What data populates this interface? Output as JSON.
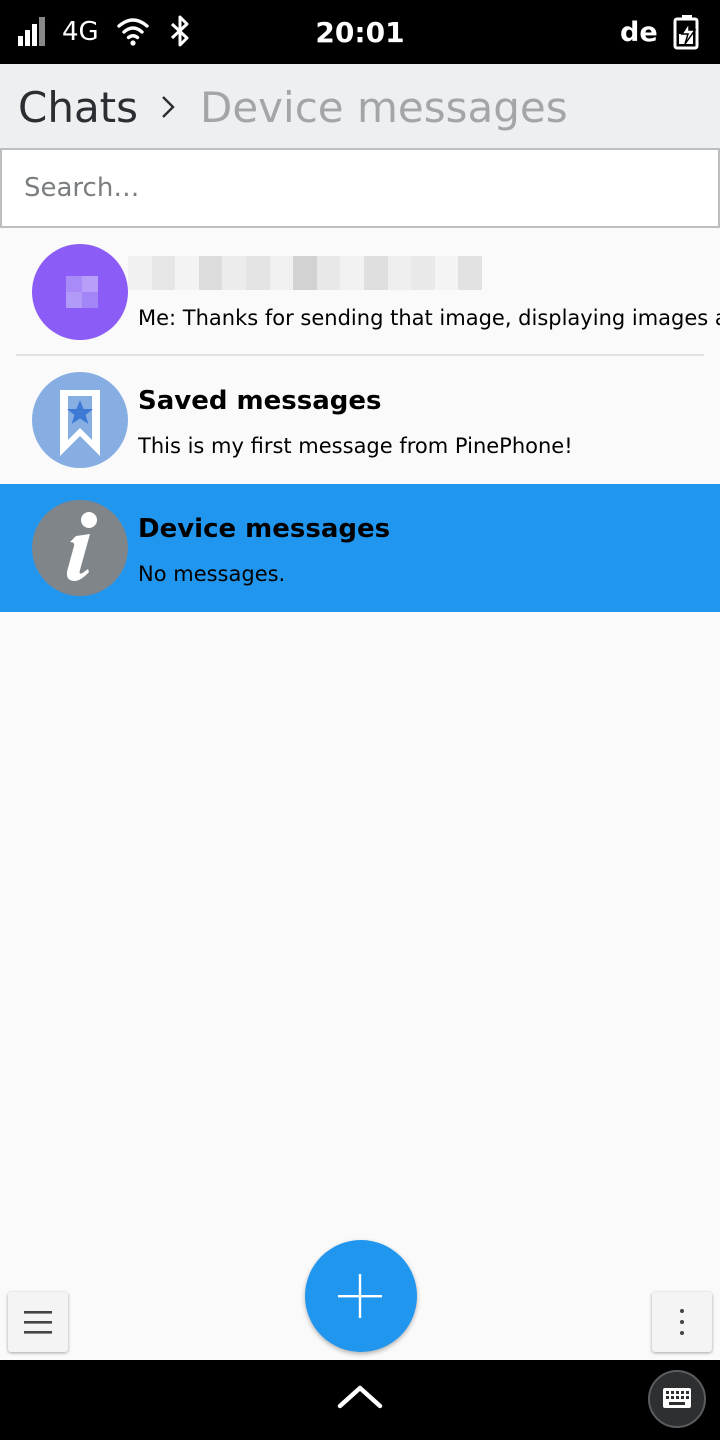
{
  "status_bar": {
    "network": "4G",
    "time": "20:01",
    "keyboard_layout": "de",
    "icons": [
      "signal-icon",
      "wifi-icon",
      "bluetooth-icon",
      "battery-charging-icon"
    ]
  },
  "header": {
    "root": "Chats",
    "current": "Device messages"
  },
  "search": {
    "placeholder": "Search…",
    "value": ""
  },
  "chats": [
    {
      "name": "",
      "name_pixelated": true,
      "preview": "Me: Thanks for sending that image, displaying images a",
      "avatar_color": "#8c5cf6",
      "selected": false
    },
    {
      "name": "Saved messages",
      "preview": "This is my first message from PinePhone!",
      "avatar_color": "#87aee3",
      "avatar_icon": "bookmark-star-icon",
      "selected": false
    },
    {
      "name": "Device messages",
      "preview": "No messages.",
      "avatar_color": "#808589",
      "avatar_icon": "info-icon",
      "selected": true
    }
  ],
  "colors": {
    "accent": "#2196ef",
    "header_bg": "#eeeff0",
    "list_bg": "#fafafa"
  },
  "bottom_bar": {
    "menu_icon": "hamburger-icon",
    "fab_icon": "plus-icon",
    "more_icon": "kebab-icon"
  },
  "nav_bar": {
    "icons": [
      "chevron-up-icon",
      "keyboard-icon"
    ]
  }
}
